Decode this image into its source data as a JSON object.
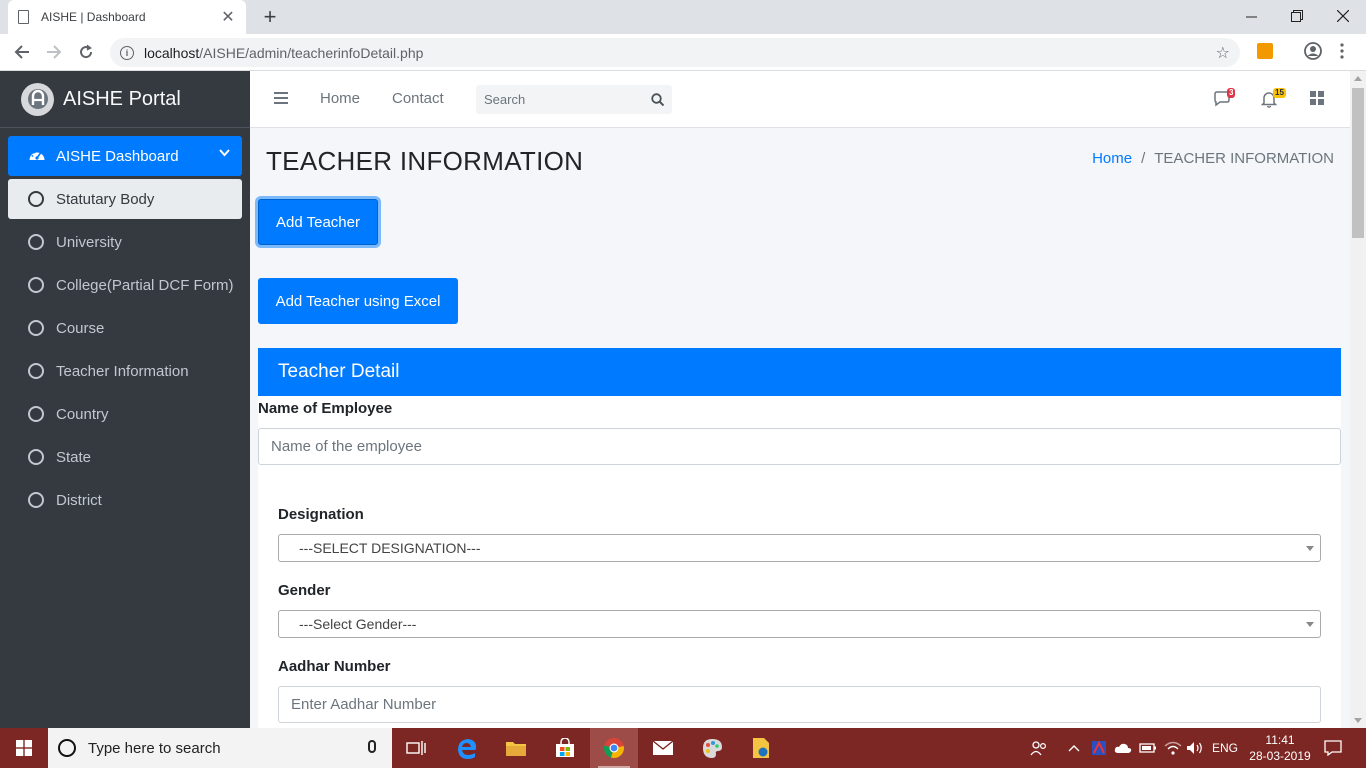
{
  "browser": {
    "tab_title": "AISHE | Dashboard",
    "url_host": "localhost",
    "url_path": "/AISHE/admin/teacherinfoDetail.php"
  },
  "sidebar": {
    "brand": "AISHE Portal",
    "dashboard_label": "AISHE Dashboard",
    "items": [
      {
        "label": "Statutary Body"
      },
      {
        "label": "University"
      },
      {
        "label": "College(Partial DCF Form)"
      },
      {
        "label": "Course"
      },
      {
        "label": "Teacher Information"
      },
      {
        "label": "Country"
      },
      {
        "label": "State"
      },
      {
        "label": "District"
      }
    ]
  },
  "topnav": {
    "home": "Home",
    "contact": "Contact",
    "search_placeholder": "Search",
    "messages_count": "3",
    "notifications_count": "15"
  },
  "page": {
    "title": "TEACHER INFORMATION",
    "breadcrumb_home": "Home",
    "breadcrumb_sep": "/",
    "breadcrumb_current": "TEACHER INFORMATION",
    "add_teacher": "Add Teacher",
    "add_teacher_excel": "Add Teacher using Excel"
  },
  "form": {
    "header": "Teacher Detail",
    "name_label": "Name of Employee",
    "name_placeholder": "Name of the employee",
    "designation_label": "Designation",
    "designation_selected": "---SELECT DESIGNATION---",
    "gender_label": "Gender",
    "gender_selected": "---Select Gender---",
    "aadhar_label": "Aadhar Number",
    "aadhar_placeholder": "Enter Aadhar Number"
  },
  "taskbar": {
    "search_text": "Type here to search",
    "language": "ENG",
    "time": "11:41",
    "date": "28-03-2019"
  },
  "colors": {
    "primary": "#007bff",
    "sidebar_bg": "#343a40",
    "taskbar_bg": "#7c2723",
    "message_badge": "#dc3545",
    "notification_badge": "#ffc107"
  }
}
